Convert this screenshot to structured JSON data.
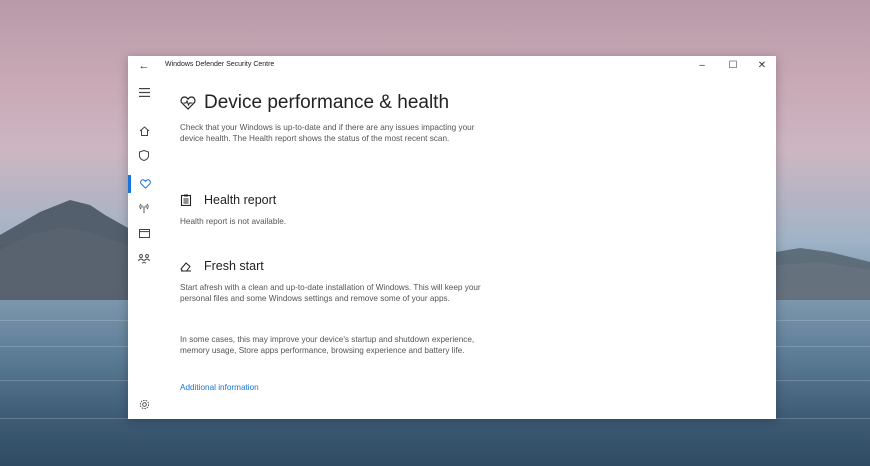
{
  "window": {
    "title": "Windows Defender Security Centre",
    "back_icon": "arrow-left-icon",
    "controls": {
      "minimize": "–",
      "maximize": "☐",
      "close": "✕"
    }
  },
  "sidebar": {
    "items": [
      {
        "icon": "hamburger-menu-icon"
      },
      {
        "icon": "home-icon"
      },
      {
        "icon": "shield-icon"
      },
      {
        "icon": "heart-icon",
        "active": true
      },
      {
        "icon": "network-antenna-icon"
      },
      {
        "icon": "browser-window-icon"
      },
      {
        "icon": "family-icon"
      },
      {
        "icon": "gear-icon"
      }
    ]
  },
  "main": {
    "title": "Device performance & health",
    "description": "Check that your Windows is up-to-date and if there are any issues impacting your device health. The Health report shows the status of the most recent scan.",
    "health_report": {
      "title": "Health report",
      "text": "Health report is not available."
    },
    "fresh_start": {
      "title": "Fresh start",
      "para1": "Start afresh with a clean and up-to-date installation of Windows. This will keep your personal files and some Windows settings and remove some of your apps.",
      "para2": "In some cases, this may improve your device's startup and shutdown experience, memory usage, Store apps performance, browsing experience and battery life.",
      "link": "Additional information"
    }
  },
  "colors": {
    "accent": "#1a73d9",
    "text": "#222222",
    "secondary_text": "#555555"
  }
}
